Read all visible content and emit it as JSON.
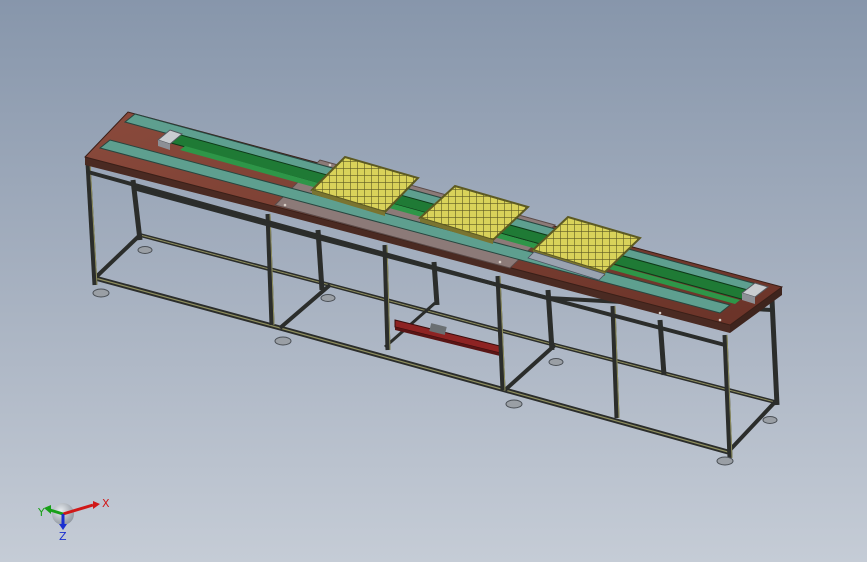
{
  "colors": {
    "background_top": "#8796ab",
    "background_bottom": "#c5ccd6",
    "frame": "#2b2d2b",
    "frame_highlight": "#9a9a6a",
    "tabletop_wood": "#7b3f34",
    "tabletop_plate": "#8c7a78",
    "rail_teal": "#5e9f8f",
    "rail_green": "#1f7a35",
    "tray_yellow": "#c8c24a",
    "tray_grid": "#5d5a22",
    "actuator_red": "#8e2323",
    "foot_grey": "#9a9fa5"
  },
  "triad": {
    "x_label": "X",
    "y_label": "Y",
    "z_label": "Z",
    "x_color": "#d01818",
    "y_color": "#18a018",
    "z_color": "#1a2fd0"
  }
}
